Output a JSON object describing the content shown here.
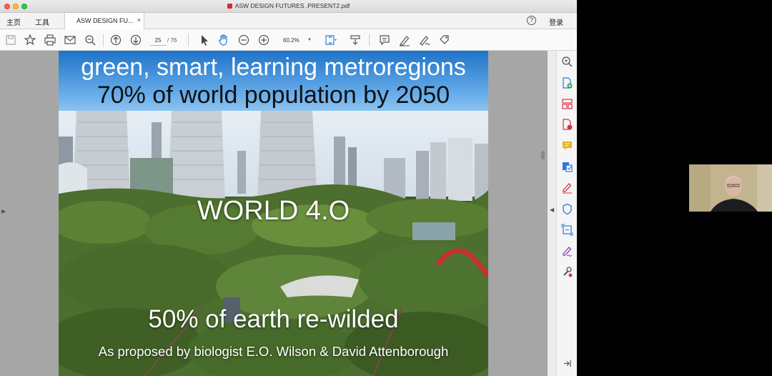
{
  "window": {
    "title": "ASW DESIGN FUTURES .PRESENT2.pdf"
  },
  "nav": {
    "home": "主页",
    "tools": "工具",
    "signin": "登录",
    "help": "?"
  },
  "tab": {
    "label": "ASW DESIGN FU...",
    "close": "×"
  },
  "toolbar": {
    "page_current": "25",
    "page_total": "/ 76",
    "zoom": "60.2%"
  },
  "slide": {
    "line1": "green, smart, learning metroregions",
    "line2": "70% of world population by 2050",
    "line3": "WORLD 4.O",
    "line4": "50% of earth re-wilded",
    "line5": "As proposed by biologist E.O. Wilson & David Attenborough"
  },
  "colors": {
    "accent_tool_blue": "#2a7ad6",
    "accent_tool_red": "#d8344a",
    "accent_tool_yellow": "#e5b21c",
    "accent_tool_purple": "#8b3db4"
  }
}
